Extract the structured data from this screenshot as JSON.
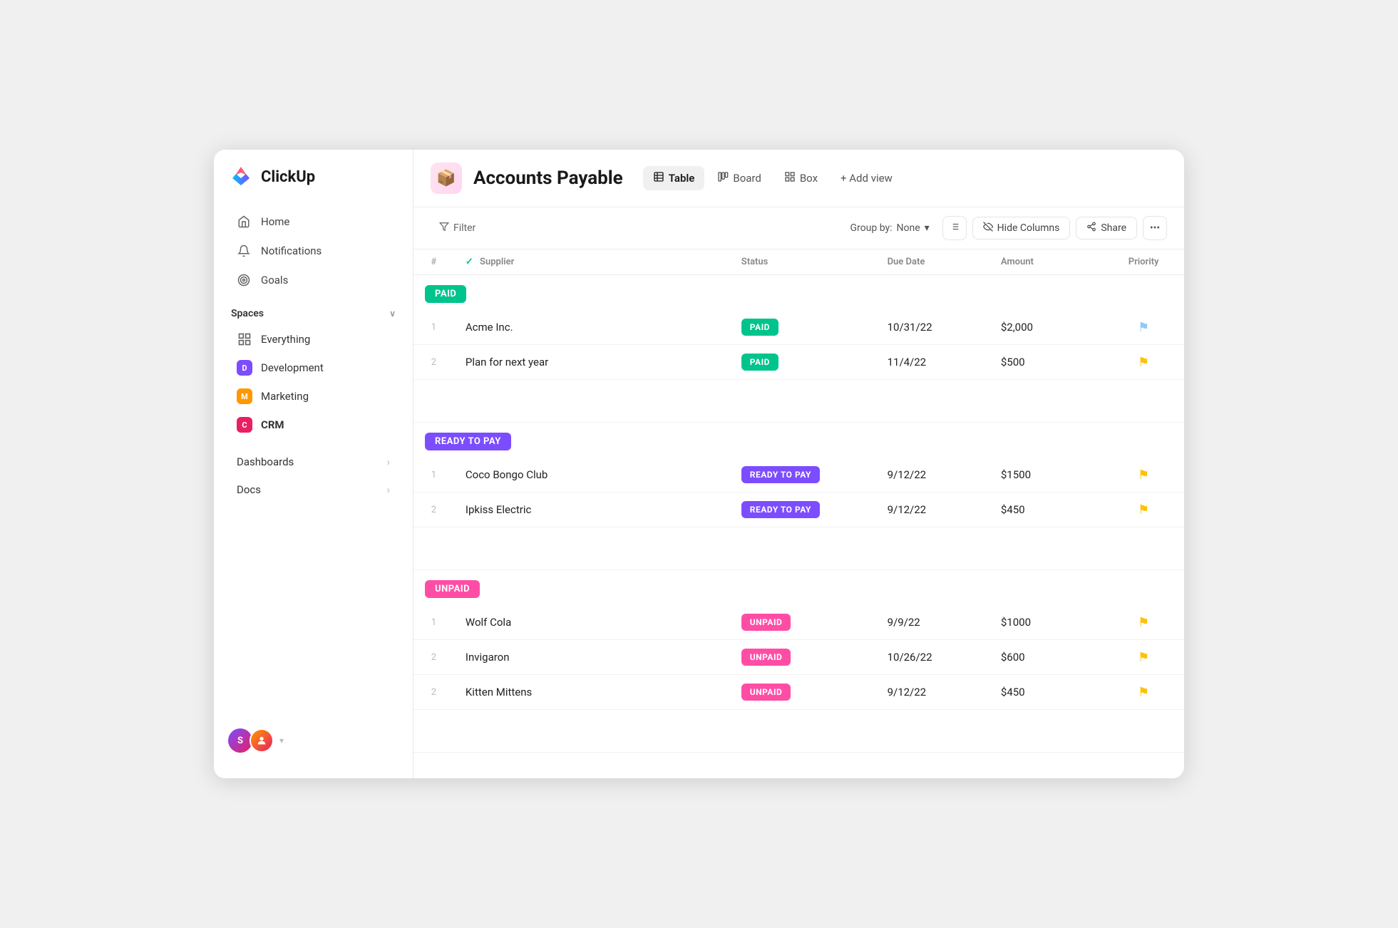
{
  "app": {
    "name": "ClickUp"
  },
  "sidebar": {
    "nav": [
      {
        "id": "home",
        "label": "Home",
        "icon": "🏠"
      },
      {
        "id": "notifications",
        "label": "Notifications",
        "icon": "🔔"
      },
      {
        "id": "goals",
        "label": "Goals",
        "icon": "🏆"
      }
    ],
    "spaces_label": "Spaces",
    "spaces": [
      {
        "id": "everything",
        "label": "Everything",
        "type": "everything"
      },
      {
        "id": "development",
        "label": "Development",
        "color": "#7c4dff",
        "letter": "D"
      },
      {
        "id": "marketing",
        "label": "Marketing",
        "color": "#ff9800",
        "letter": "M"
      },
      {
        "id": "crm",
        "label": "CRM",
        "color": "#e91e63",
        "letter": "C",
        "bold": true
      }
    ],
    "sections": [
      {
        "id": "dashboards",
        "label": "Dashboards"
      },
      {
        "id": "docs",
        "label": "Docs"
      }
    ]
  },
  "header": {
    "page_icon": "📦",
    "page_title": "Accounts Payable",
    "views": [
      {
        "id": "table",
        "label": "Table",
        "active": true
      },
      {
        "id": "board",
        "label": "Board",
        "active": false
      },
      {
        "id": "box",
        "label": "Box",
        "active": false
      }
    ],
    "add_view_label": "+ Add view"
  },
  "toolbar": {
    "filter_label": "Filter",
    "group_by_label": "Group by:",
    "group_by_value": "None",
    "hide_columns_label": "Hide Columns",
    "share_label": "Share"
  },
  "table": {
    "columns": [
      {
        "id": "num",
        "label": "#"
      },
      {
        "id": "supplier",
        "label": "Supplier"
      },
      {
        "id": "status",
        "label": "Status"
      },
      {
        "id": "duedate",
        "label": "Due Date"
      },
      {
        "id": "amount",
        "label": "Amount"
      },
      {
        "id": "priority",
        "label": "Priority"
      }
    ],
    "groups": [
      {
        "id": "paid",
        "label": "PAID",
        "type": "paid",
        "rows": [
          {
            "num": 1,
            "supplier": "Acme Inc.",
            "status": "PAID",
            "status_type": "paid",
            "due_date": "10/31/22",
            "amount": "$2,000",
            "priority": "blue"
          },
          {
            "num": 2,
            "supplier": "Plan for next year",
            "status": "PAID",
            "status_type": "paid",
            "due_date": "11/4/22",
            "amount": "$500",
            "priority": "yellow"
          }
        ]
      },
      {
        "id": "ready",
        "label": "READY TO PAY",
        "type": "ready",
        "rows": [
          {
            "num": 1,
            "supplier": "Coco Bongo Club",
            "status": "READY TO PAY",
            "status_type": "ready",
            "due_date": "9/12/22",
            "amount": "$1500",
            "priority": "yellow"
          },
          {
            "num": 2,
            "supplier": "Ipkiss Electric",
            "status": "READY TO PAY",
            "status_type": "ready",
            "due_date": "9/12/22",
            "amount": "$450",
            "priority": "yellow"
          }
        ]
      },
      {
        "id": "unpaid",
        "label": "UNPAID",
        "type": "unpaid",
        "rows": [
          {
            "num": 1,
            "supplier": "Wolf Cola",
            "status": "UNPAID",
            "status_type": "unpaid",
            "due_date": "9/9/22",
            "amount": "$1000",
            "priority": "yellow"
          },
          {
            "num": 2,
            "supplier": "Invigaron",
            "status": "UNPAID",
            "status_type": "unpaid",
            "due_date": "10/26/22",
            "amount": "$600",
            "priority": "yellow"
          },
          {
            "num": 2,
            "supplier": "Kitten Mittens",
            "status": "UNPAID",
            "status_type": "unpaid",
            "due_date": "9/12/22",
            "amount": "$450",
            "priority": "yellow"
          }
        ]
      }
    ]
  }
}
